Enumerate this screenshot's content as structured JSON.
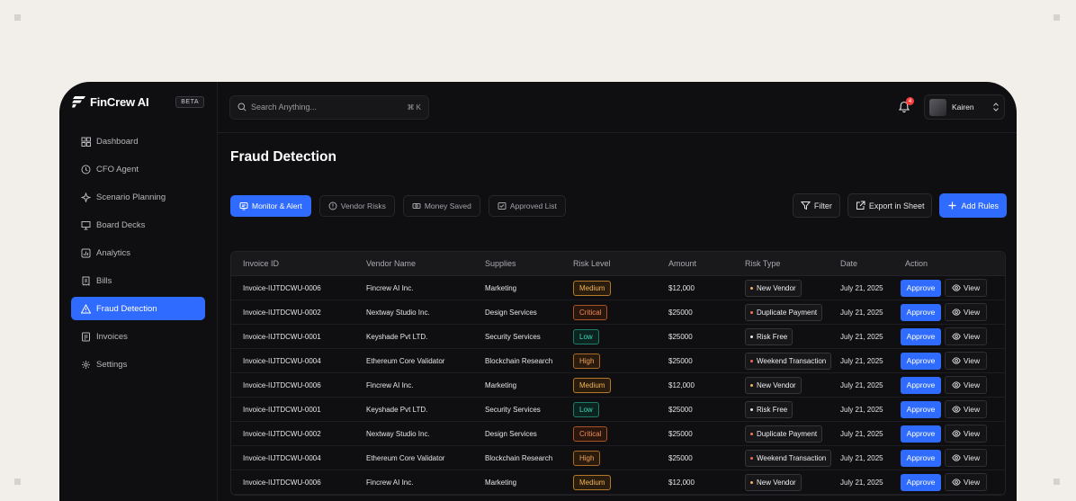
{
  "app": {
    "brand": "FinCrew AI",
    "beta": "BETA"
  },
  "sidebar": {
    "items": [
      {
        "label": "Dashboard",
        "icon": "grid-icon"
      },
      {
        "label": "CFO Agent",
        "icon": "clock-icon"
      },
      {
        "label": "Scenario Planning",
        "icon": "spark-icon"
      },
      {
        "label": "Board Decks",
        "icon": "presentation-icon"
      },
      {
        "label": "Analytics",
        "icon": "chart-icon"
      },
      {
        "label": "Bills",
        "icon": "bill-icon"
      },
      {
        "label": "Fraud Detection",
        "icon": "alert-icon",
        "active": true
      },
      {
        "label": "Invoices",
        "icon": "invoice-icon"
      },
      {
        "label": "Settings",
        "icon": "gear-icon"
      }
    ]
  },
  "topbar": {
    "search_placeholder": "Search Anything...",
    "shortcut": "⌘ K",
    "notification_count": "4",
    "user_name": "Kairen"
  },
  "page": {
    "title": "Fraud Detection"
  },
  "tabs": [
    {
      "label": "Monitor & Alert",
      "active": true
    },
    {
      "label": "Vendor Risks"
    },
    {
      "label": "Money Saved"
    },
    {
      "label": "Approved List"
    }
  ],
  "actions": {
    "filter": "Filter",
    "export": "Export in Sheet",
    "add_rules": "Add Rules"
  },
  "table": {
    "headers": [
      "Invoice ID",
      "Vendor Name",
      "Supplies",
      "Risk Level",
      "Amount",
      "Risk Type",
      "Date",
      "Action"
    ],
    "approve_label": "Approve",
    "view_label": "View",
    "rows": [
      {
        "id": "Invoice-IIJTDCWU-0006",
        "vendor": "Fincrew AI Inc.",
        "supplies": "Marketing",
        "risk": "Medium",
        "amount": "$12,000",
        "type": "New Vendor",
        "date": "July 21, 2025"
      },
      {
        "id": "Invoice-IIJTDCWU-0002",
        "vendor": "Nextway Studio Inc.",
        "supplies": "Design Services",
        "risk": "Critical",
        "amount": "$25000",
        "type": "Duplicate Payment",
        "date": "July 21, 2025"
      },
      {
        "id": "Invoice-IIJTDCWU-0001",
        "vendor": "Keyshade Pvt LTD.",
        "supplies": "Security Services",
        "risk": "Low",
        "amount": "$25000",
        "type": "Risk Free",
        "date": "July 21, 2025"
      },
      {
        "id": "Invoice-IIJTDCWU-0004",
        "vendor": "Ethereum Core Validator",
        "supplies": "Blockchain Research",
        "risk": "High",
        "amount": "$25000",
        "type": "Weekend Transaction",
        "date": "July 21, 2025"
      },
      {
        "id": "Invoice-IIJTDCWU-0006",
        "vendor": "Fincrew AI Inc.",
        "supplies": "Marketing",
        "risk": "Medium",
        "amount": "$12,000",
        "type": "New Vendor",
        "date": "July 21, 2025"
      },
      {
        "id": "Invoice-IIJTDCWU-0001",
        "vendor": "Keyshade Pvt LTD.",
        "supplies": "Security Services",
        "risk": "Low",
        "amount": "$25000",
        "type": "Risk Free",
        "date": "July 21, 2025"
      },
      {
        "id": "Invoice-IIJTDCWU-0002",
        "vendor": "Nextway Studio Inc.",
        "supplies": "Design Services",
        "risk": "Critical",
        "amount": "$25000",
        "type": "Duplicate Payment",
        "date": "July 21, 2025"
      },
      {
        "id": "Invoice-IIJTDCWU-0004",
        "vendor": "Ethereum Core Validator",
        "supplies": "Blockchain Research",
        "risk": "High",
        "amount": "$25000",
        "type": "Weekend Transaction",
        "date": "July 21, 2025"
      },
      {
        "id": "Invoice-IIJTDCWU-0006",
        "vendor": "Fincrew AI Inc.",
        "supplies": "Marketing",
        "risk": "Medium",
        "amount": "$12,000",
        "type": "New Vendor",
        "date": "July 21, 2025"
      }
    ]
  },
  "colors": {
    "accent": "#2f6bff",
    "risk_dot_new": "#f0b35a",
    "risk_dot_dup": "#f07a4a",
    "risk_dot_free": "#e8e8ea",
    "risk_dot_weekend": "#f06a4a"
  }
}
